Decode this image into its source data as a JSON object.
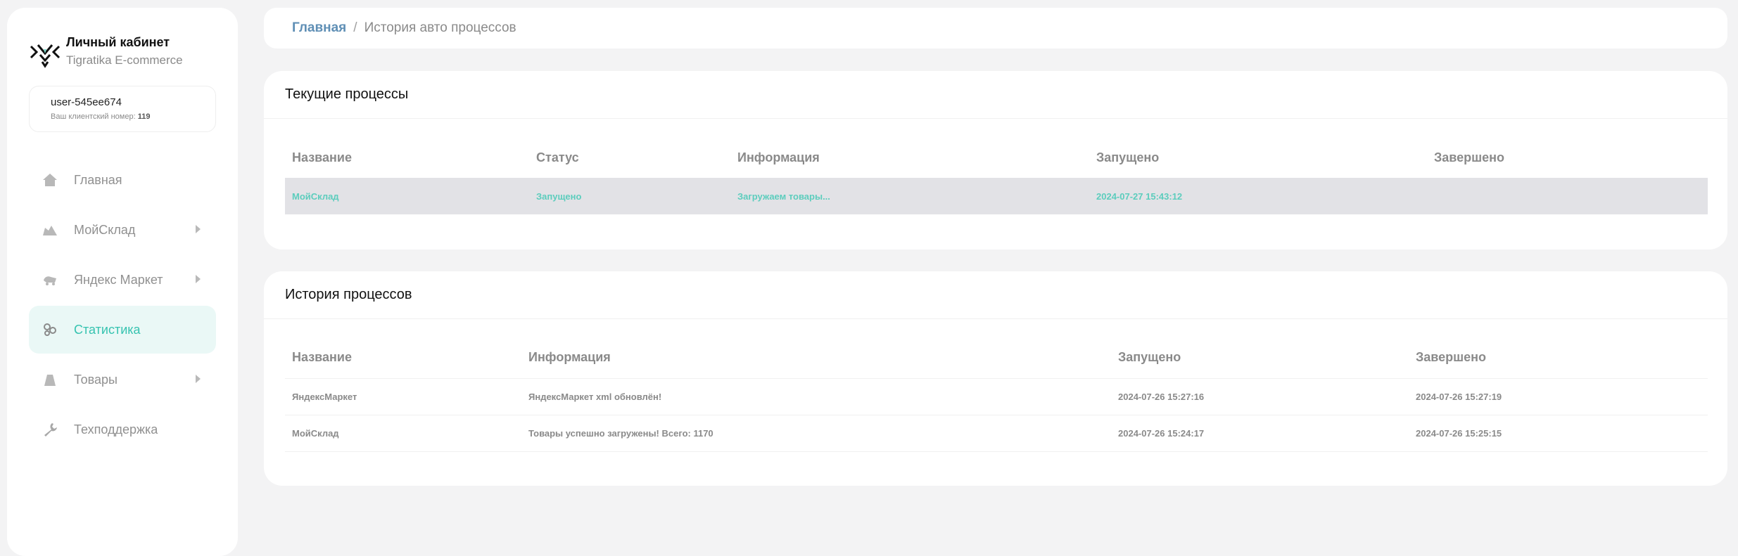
{
  "brand": {
    "title": "Личный кабинет",
    "subtitle": "Tigratika E-commerce"
  },
  "user": {
    "name": "user-545ee674",
    "client_label": "Ваш клиентский номер:",
    "client_number": "119"
  },
  "nav": [
    {
      "label": "Главная",
      "icon": "home-icon"
    },
    {
      "label": "МойСклад",
      "icon": "warehouse-icon"
    },
    {
      "label": "Яндекс Маркет",
      "icon": "cart-icon"
    },
    {
      "label": "Статистика",
      "icon": "stats-icon",
      "active": true
    },
    {
      "label": "Товары",
      "icon": "bag-icon"
    },
    {
      "label": "Техподдержка",
      "icon": "wrench-icon"
    }
  ],
  "breadcrumb": {
    "home": "Главная",
    "separator": "/",
    "current": "История авто процессов"
  },
  "current": {
    "title": "Текущие процессы",
    "columns": [
      "Название",
      "Статус",
      "Информация",
      "Запущено",
      "Завершено"
    ],
    "rows": [
      {
        "name": "МойСклад",
        "status": "Запущено",
        "info": "Загружаем товары...",
        "started": "2024-07-27 15:43:12",
        "finished": ""
      }
    ]
  },
  "history": {
    "title": "История процессов",
    "columns": [
      "Название",
      "Информация",
      "Запущено",
      "Завершено"
    ],
    "rows": [
      {
        "name": "ЯндексМаркет",
        "info": "ЯндексМаркет xml обновлён!",
        "started": "2024-07-26 15:27:16",
        "finished": "2024-07-26 15:27:19"
      },
      {
        "name": "МойСклад",
        "info": "Товары успешно загружены! Всего: 1170",
        "started": "2024-07-26 15:24:17",
        "finished": "2024-07-26 15:25:15"
      }
    ]
  },
  "colors": {
    "accent": "#36c3b0",
    "link": "#5f8fb5",
    "active_bg": "#eaf8f6",
    "running_row_bg": "#e2e2e6"
  }
}
